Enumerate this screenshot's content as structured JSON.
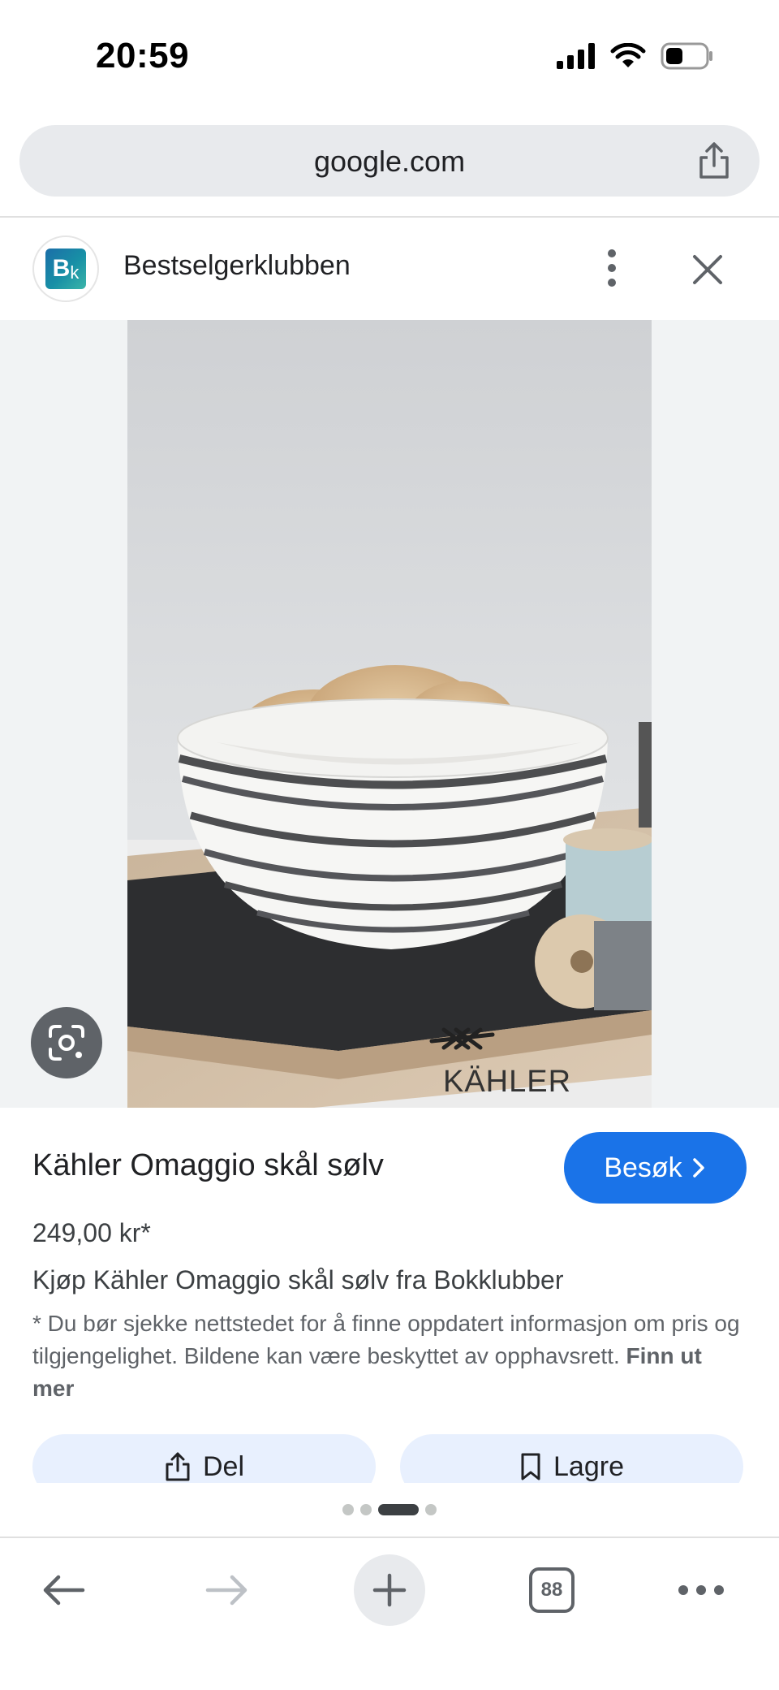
{
  "status_bar": {
    "time": "20:59"
  },
  "url_bar": {
    "url": "google.com"
  },
  "header": {
    "site_name": "Bestselgerklubben",
    "logo_letters": "Bk"
  },
  "image": {
    "watermark_brand": "KÄHLER"
  },
  "product": {
    "title": "Kähler Omaggio skål sølv",
    "visit_label": "Besøk",
    "price": "249,00 kr*",
    "subtitle": "Kjøp Kähler Omaggio skål sølv fra Bokklubber",
    "disclaimer": "* Du bør sjekke nettstedet for å finne oppdatert informasjon om pris og tilgjengelighet. Bildene kan være beskyttet av opphavsrett.",
    "learn_more": "Finn ut mer"
  },
  "actions": {
    "share_label": "Del",
    "save_label": "Lagre"
  },
  "pager": {
    "count": 4,
    "active_index": 2
  },
  "bottom_nav": {
    "tab_count": "88"
  },
  "colors": {
    "accent": "#1a73e8",
    "button_bg": "#e8f0fe",
    "url_bar_bg": "#e8eaed"
  },
  "icons": [
    "signal-icon",
    "wifi-icon",
    "battery-icon",
    "share-icon",
    "more-vert-icon",
    "close-icon",
    "lens-icon",
    "chevron-right-icon",
    "bookmark-icon",
    "back-arrow-icon",
    "forward-arrow-icon",
    "plus-icon",
    "tabs-icon",
    "more-horiz-icon"
  ]
}
